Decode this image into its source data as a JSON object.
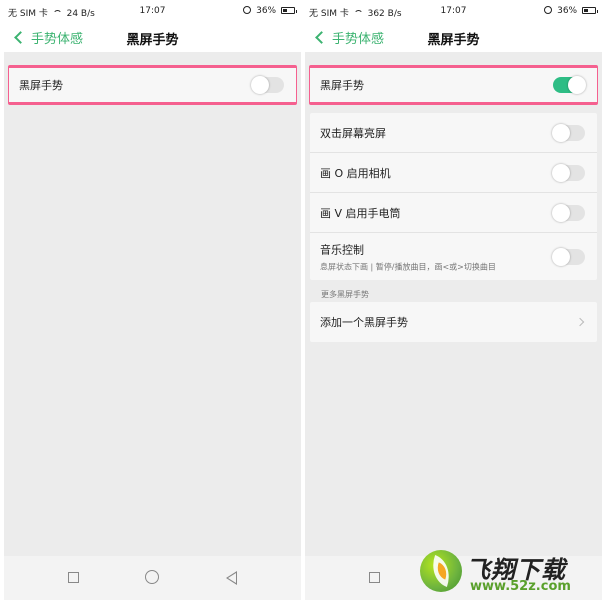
{
  "colors": {
    "accent": "#3cb371",
    "switch_on": "#2ebd85",
    "switch_off": "#e3e3e3",
    "highlight_outline": "#f5608f",
    "page_bg": "#ececec"
  },
  "left_screen": {
    "status_bar": {
      "carrier": "无 SIM 卡",
      "speed": "24 B/s",
      "time": "17:07",
      "battery": "36%"
    },
    "nav": {
      "back_label": "手势体感",
      "title": "黑屏手势"
    },
    "master_toggle": {
      "label": "黑屏手势",
      "on": false
    }
  },
  "right_screen": {
    "status_bar": {
      "carrier": "无 SIM 卡",
      "speed": "362 B/s",
      "time": "17:07",
      "battery": "36%"
    },
    "nav": {
      "back_label": "手势体感",
      "title": "黑屏手势"
    },
    "master_toggle": {
      "label": "黑屏手势",
      "on": true
    },
    "gestures": [
      {
        "label": "双击屏幕亮屏",
        "on": false
      },
      {
        "label": "画 O 启用相机",
        "on": false
      },
      {
        "label": "画 V 启用手电筒",
        "on": false
      },
      {
        "label": "音乐控制",
        "desc": "息屏状态下画 | 暂停/播放曲目，画<或>切换曲目",
        "on": false
      }
    ],
    "more_section_title": "更多黑屏手势",
    "add_gesture_label": "添加一个黑屏手势"
  },
  "system_nav_icons": [
    "recents-square-icon",
    "home-circle-icon",
    "back-triangle-icon"
  ],
  "watermark": {
    "name": "飞翔下载",
    "url": "www.52z.com"
  }
}
